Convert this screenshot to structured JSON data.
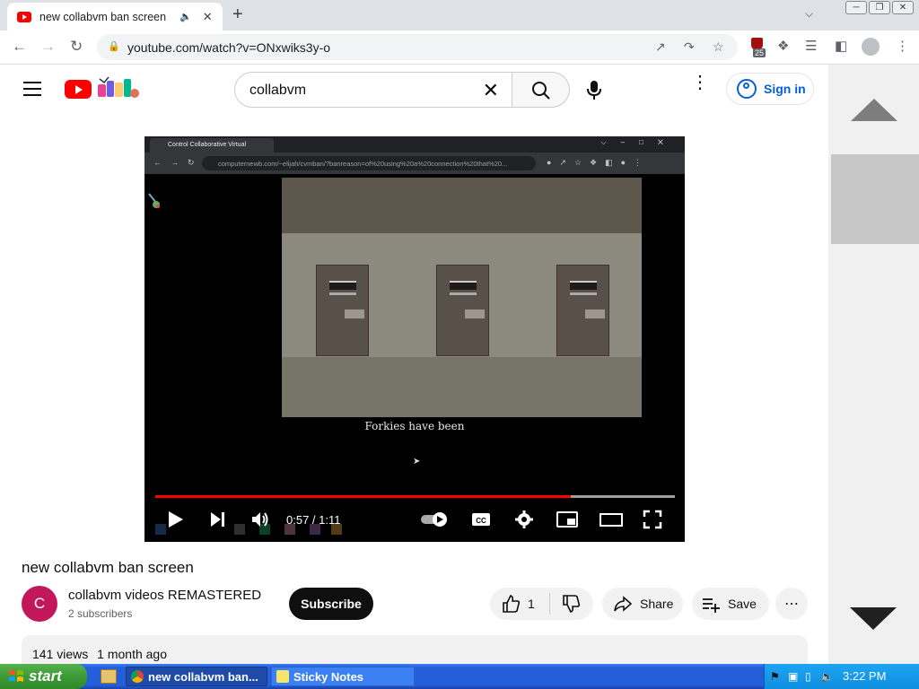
{
  "browser": {
    "tab_title": "new collabvm ban screen",
    "url": "youtube.com/watch?v=ONxwiks3y-o",
    "extension_badge": "25"
  },
  "youtube": {
    "search_query": "collabvm",
    "sign_in_label": "Sign in"
  },
  "video": {
    "inner_tab_title": "Control Collaborative Virtual",
    "inner_url": "computernewb.com/~elijah/cvmban/?banreason=of%20using%20a%20connection%20that%20...",
    "subtitle": "Forkies have been",
    "time_display": "0:57 / 1:11",
    "progress_fraction": 0.8,
    "title": "new collabvm ban screen"
  },
  "channel": {
    "initial": "C",
    "name": "collabvm videos REMASTERED",
    "subscribers": "2 subscribers",
    "subscribe_label": "Subscribe"
  },
  "actions": {
    "like_count": "1",
    "share_label": "Share",
    "save_label": "Save"
  },
  "description": {
    "views": "141 views",
    "age": "1 month ago"
  },
  "taskbar": {
    "start_label": "start",
    "items": [
      {
        "label": "new collabvm ban..."
      },
      {
        "label": "Sticky Notes"
      }
    ],
    "clock": "3:22 PM"
  }
}
